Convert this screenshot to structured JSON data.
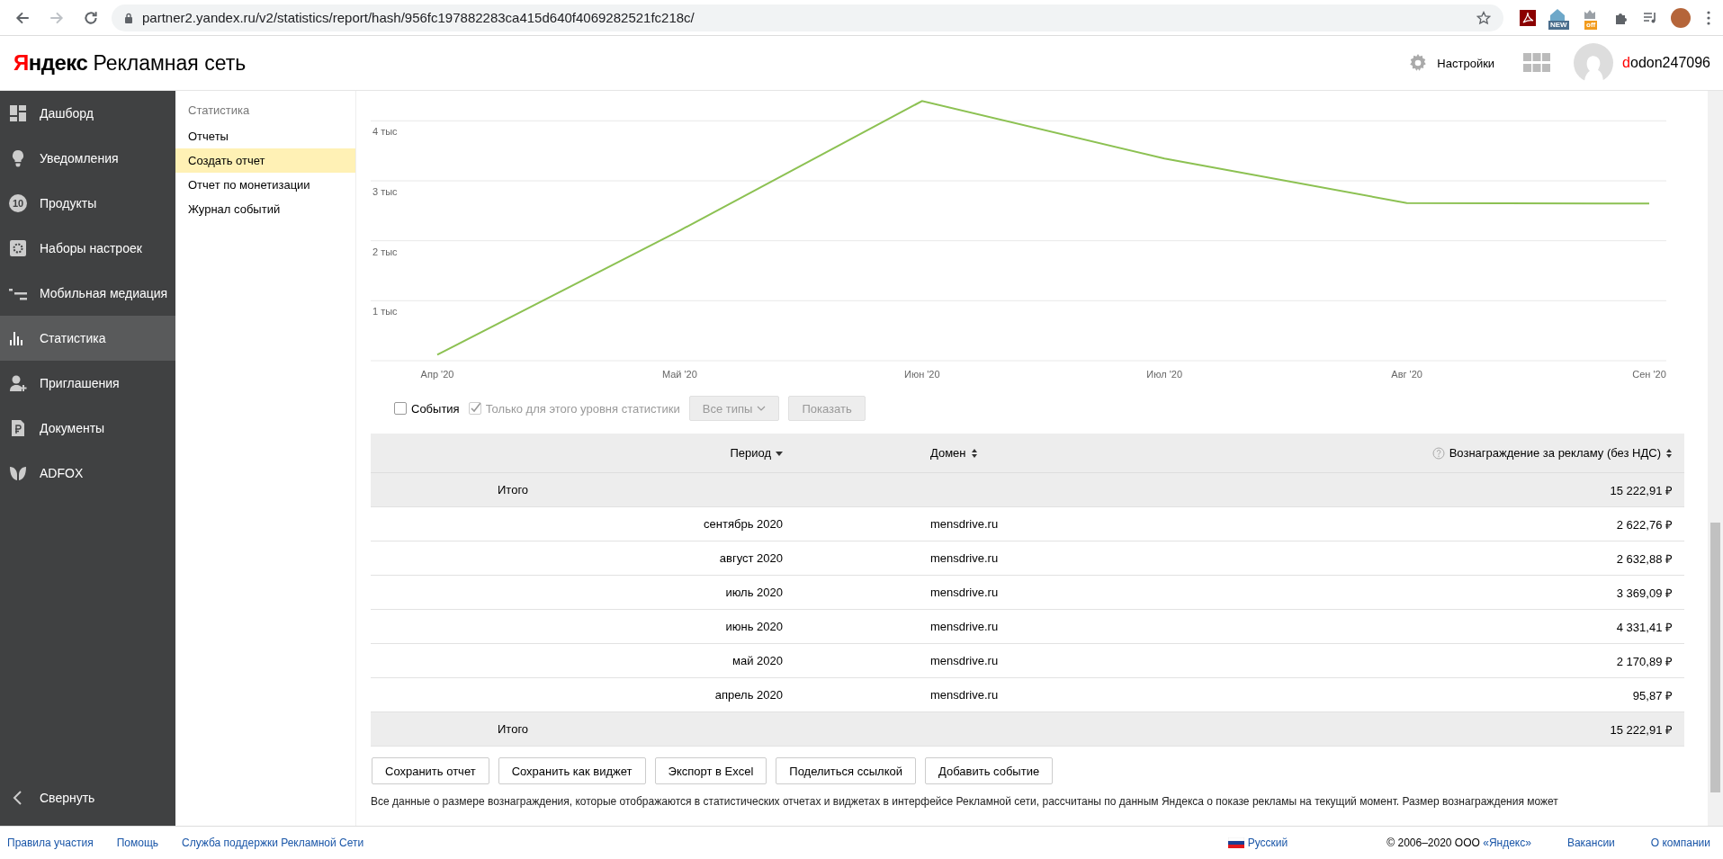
{
  "browser": {
    "url": "partner2.yandex.ru/v2/statistics/report/hash/956fc197882283ca415d640f4069282521fc218c/",
    "forward_disabled": true,
    "extension_badges": [
      "NEW",
      "off"
    ]
  },
  "header": {
    "logo_brand": "Яндекс",
    "logo_product": "Рекламная сеть",
    "settings": "Настройки",
    "username": "dodon247096"
  },
  "sidebar": {
    "items": [
      {
        "label": "Дашборд",
        "kind": "dashboard",
        "selected": false
      },
      {
        "label": "Уведомления",
        "kind": "bulb",
        "selected": false
      },
      {
        "label": "Продукты",
        "kind": "count",
        "badge": "10",
        "selected": false
      },
      {
        "label": "Наборы настроек",
        "kind": "gear",
        "selected": false
      },
      {
        "label": "Мобильная медиация",
        "kind": "lines",
        "selected": false
      },
      {
        "label": "Статистика",
        "kind": "bars",
        "selected": true
      },
      {
        "label": "Приглашения",
        "kind": "person",
        "selected": false
      },
      {
        "label": "Документы",
        "kind": "doc",
        "selected": false
      },
      {
        "label": "ADFOX",
        "kind": "leaf",
        "selected": false
      }
    ],
    "collapse": "Свернуть"
  },
  "subnav": {
    "title": "Статистика",
    "items": [
      {
        "label": "Отчеты",
        "selected": false
      },
      {
        "label": "Создать отчет",
        "selected": true
      },
      {
        "label": "Отчет по монетизации",
        "selected": false
      },
      {
        "label": "Журнал событий",
        "selected": false
      }
    ]
  },
  "chart_data": {
    "type": "line",
    "categories": [
      "Апр '20",
      "Май '20",
      "Июн '20",
      "Июл '20",
      "Авг '20",
      "Сен '20"
    ],
    "series": [
      {
        "color": "#8cc152",
        "values": [
          0.1,
          2.17,
          4.33,
          3.37,
          2.63,
          2.62
        ]
      }
    ],
    "ylim": [
      0,
      4.5
    ],
    "grid": true,
    "yticks": [
      {
        "value": 1,
        "label": "1 тыс"
      },
      {
        "value": 2,
        "label": "2 тыс"
      },
      {
        "value": 3,
        "label": "3 тыс"
      },
      {
        "value": 4,
        "label": "4 тыс"
      }
    ]
  },
  "controls": {
    "events": {
      "label": "События",
      "checked": false
    },
    "level_only": {
      "label": "Только для этого уровня статистики",
      "checked": true,
      "disabled": true
    },
    "types": {
      "label": "Все типы",
      "disabled": true
    },
    "show": {
      "label": "Показать",
      "disabled": true
    }
  },
  "table": {
    "columns": [
      {
        "label": "Период",
        "sorted": true
      },
      {
        "label": "Домен",
        "sorted": false
      },
      {
        "label": "Вознаграждение за рекламу (без НДС)",
        "sorted": false,
        "help": true
      }
    ],
    "total_top": {
      "label": "Итого",
      "value": "15 222,91 ₽"
    },
    "rows": [
      {
        "period": "сентябрь 2020",
        "domain": "mensdrive.ru",
        "reward": "2 622,76 ₽"
      },
      {
        "period": "август 2020",
        "domain": "mensdrive.ru",
        "reward": "2 632,88 ₽"
      },
      {
        "period": "июль 2020",
        "domain": "mensdrive.ru",
        "reward": "3 369,09 ₽"
      },
      {
        "period": "июнь 2020",
        "domain": "mensdrive.ru",
        "reward": "4 331,41 ₽"
      },
      {
        "period": "май 2020",
        "domain": "mensdrive.ru",
        "reward": "2 170,89 ₽"
      },
      {
        "period": "апрель 2020",
        "domain": "mensdrive.ru",
        "reward": "95,87 ₽"
      }
    ],
    "total_bottom": {
      "label": "Итого",
      "value": "15 222,91 ₽"
    }
  },
  "actions": [
    "Сохранить отчет",
    "Сохранить как виджет",
    "Экспорт в Excel",
    "Поделиться ссылкой",
    "Добавить событие"
  ],
  "note": "Все данные о размере вознаграждения, которые отображаются в статистических отчетах и виджетах в интерфейсе Рекламной сети, рассчитаны по данным Яндекса о показе рекламы на текущий момент. Размер вознаграждения может",
  "footer": {
    "links": [
      "Правила участия",
      "Помощь",
      "Служба поддержки Рекламной Сети"
    ],
    "language": "Русский",
    "copyright": "© 2006–2020 ООО",
    "company_link": "«Яндекс»",
    "right_links": [
      "Вакансии",
      "О компании"
    ]
  }
}
